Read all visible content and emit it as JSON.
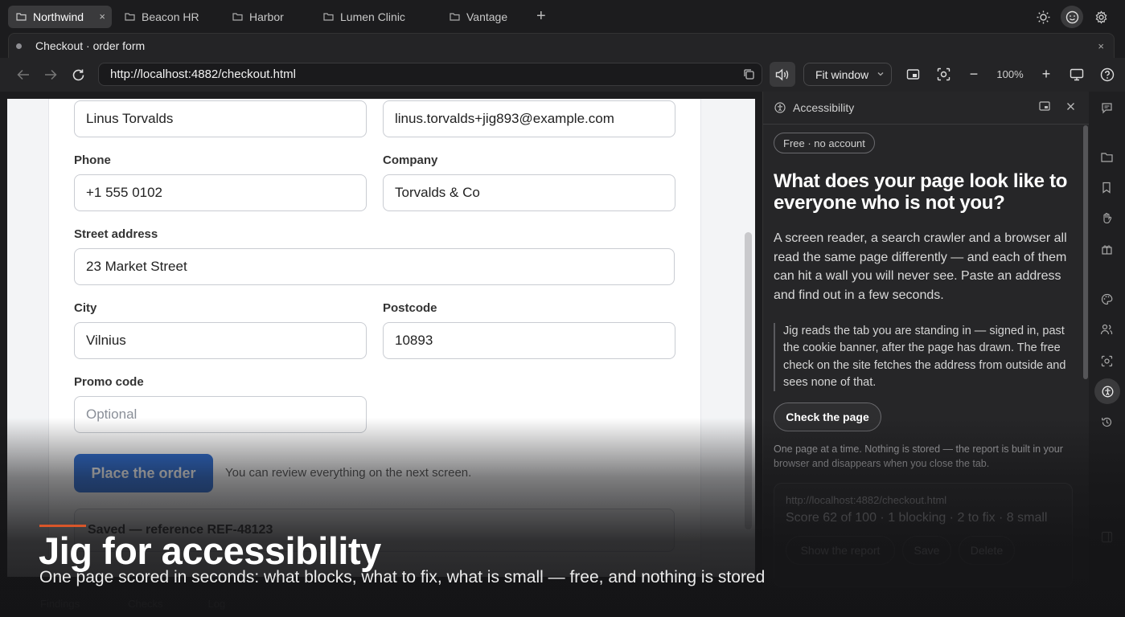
{
  "tabs": [
    {
      "label": "Northwind",
      "active": true
    },
    {
      "label": "Beacon HR"
    },
    {
      "label": "Harbor"
    },
    {
      "label": "Lumen Clinic"
    },
    {
      "label": "Vantage"
    }
  ],
  "tab_close": "×",
  "tab_add": "+",
  "page_title": "Checkout · order form",
  "page_close": "×",
  "url": "http://localhost:4882/checkout.html",
  "zoom_mode": "Fit window",
  "zoom_level": "100%",
  "zoom_minus": "−",
  "zoom_plus": "+",
  "form": {
    "name_value": "Linus Torvalds",
    "email_value": "linus.torvalds+jig893@example.com",
    "phone_label": "Phone",
    "phone_value": "+1 555 0102",
    "company_label": "Company",
    "company_value": "Torvalds & Co",
    "street_label": "Street address",
    "street_value": "23 Market Street",
    "city_label": "City",
    "city_value": "Vilnius",
    "postcode_label": "Postcode",
    "postcode_value": "10893",
    "promo_label": "Promo code",
    "promo_placeholder": "Optional",
    "submit_label": "Place the order",
    "submit_hint": "You can review everything on the next screen.",
    "saved_message": "Saved — reference REF-48123"
  },
  "panel": {
    "title": "Accessibility",
    "badge": "Free · no account",
    "headline": "What does your page look like to everyone who is not you?",
    "paragraph": "A screen reader, a search crawler and a browser all read the same page differently — and each of them can hit a wall you will never see. Paste an address and find out in a few seconds.",
    "quote": "Jig reads the tab you are standing in — signed in, past the cookie banner, after the page has drawn. The free check on the site fetches the address from outside and sees none of that.",
    "check_button": "Check the page",
    "note": "One page at a time. Nothing is stored — the report is built in your browser and disappears when you close the tab.",
    "report": {
      "url": "http://localhost:4882/checkout.html",
      "summary": "Score 62 of 100 · 1 blocking · 2 to fix · 8 small",
      "show_button": "Show the report",
      "save_button": "Save",
      "delete_button": "Delete"
    }
  },
  "bottom": {
    "findings": "Findings",
    "checks": "Checks",
    "log": "Log"
  },
  "caption": {
    "title": "Jig for accessibility",
    "subtitle": "One page scored in seconds: what blocks, what to fix, what is small — free, and nothing is stored"
  },
  "colors": {
    "accent": "#d9562a",
    "primary_button": "#2f6fd6"
  }
}
